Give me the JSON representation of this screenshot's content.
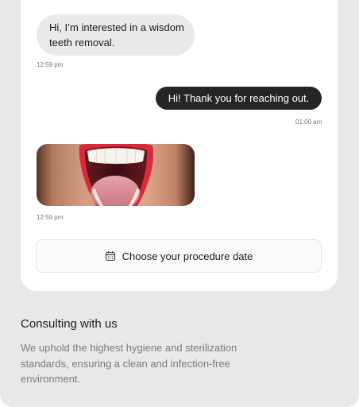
{
  "chat": {
    "messages": [
      {
        "direction": "incoming",
        "text": "Hi, I’m interested in a wisdom teeth removal.",
        "time": "12:59 pm"
      },
      {
        "direction": "outgoing",
        "text": "Hi! Thank you for reaching out.",
        "time": "01:00 am"
      },
      {
        "direction": "incoming",
        "type": "image",
        "image": "open-mouth-photo",
        "time": "12:59 pm"
      }
    ],
    "date_button": {
      "label": "Choose your procedure date",
      "icon": "calendar-icon"
    }
  },
  "section": {
    "title": "Consulting with us",
    "body": "We uphold the highest hygiene and sterilization standards, ensuring a clean and infection-free environment."
  },
  "colors": {
    "background": "#e8e8e8",
    "card": "#ffffff",
    "incoming_bubble": "#e9e9e9",
    "outgoing_bubble": "#252525"
  }
}
